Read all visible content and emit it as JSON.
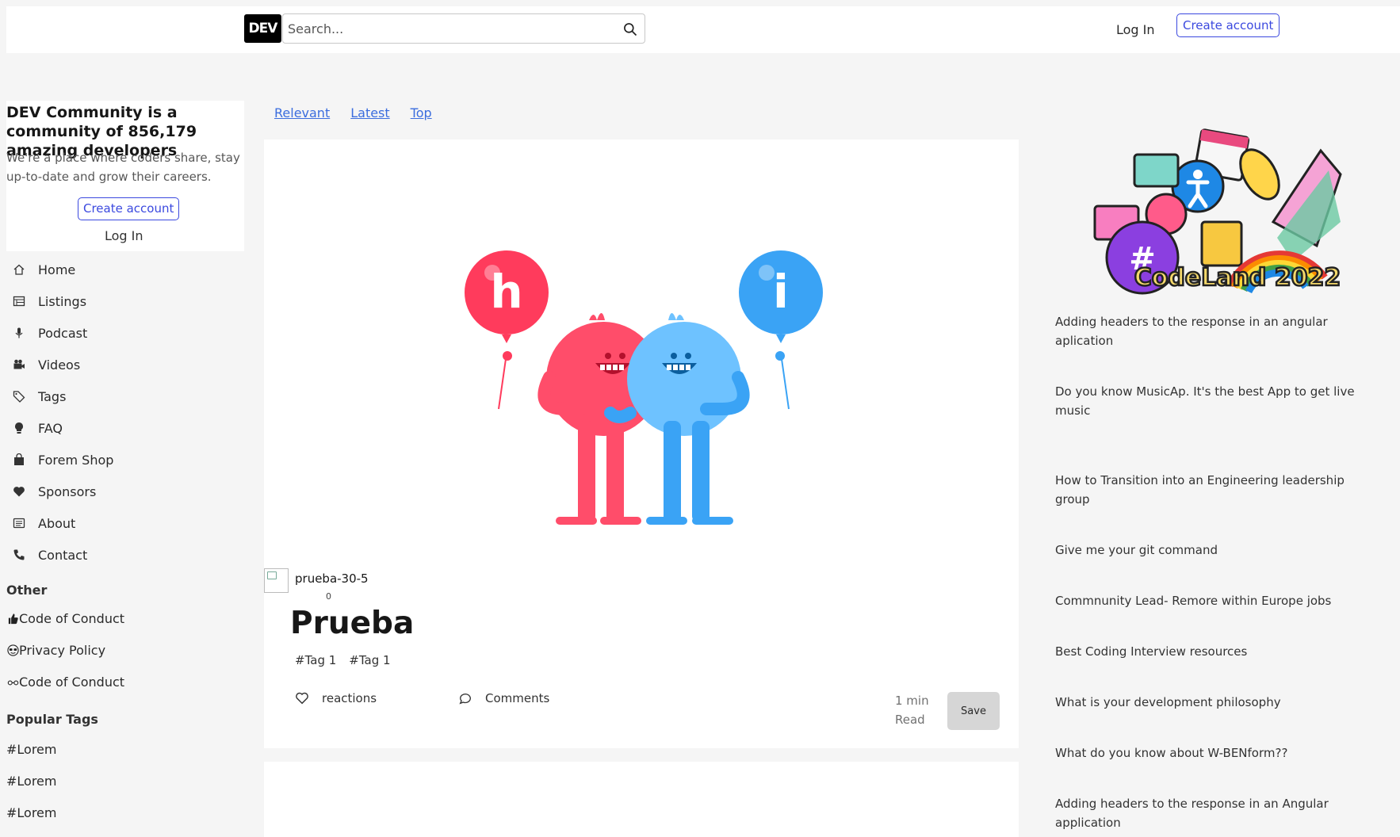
{
  "header": {
    "logo_text": "DEV",
    "search_placeholder": "Search...",
    "login_label": "Log In",
    "create_account_label": "Create account"
  },
  "intro": {
    "title": "DEV Community is a community of 856,179 amazing developers",
    "description": "We're a place where coders share, stay up-to-date and grow their careers.",
    "create_account_label": "Create account",
    "login_label": "Log In"
  },
  "nav": {
    "items": [
      {
        "label": "Home",
        "icon": "home-icon"
      },
      {
        "label": "Listings",
        "icon": "listings-icon"
      },
      {
        "label": "Podcast",
        "icon": "microphone-icon"
      },
      {
        "label": "Videos",
        "icon": "video-camera-icon"
      },
      {
        "label": "Tags",
        "icon": "tag-icon"
      },
      {
        "label": "FAQ",
        "icon": "lightbulb-icon"
      },
      {
        "label": "Forem Shop",
        "icon": "shopping-bag-icon"
      },
      {
        "label": "Sponsors",
        "icon": "heart-icon"
      },
      {
        "label": "About",
        "icon": "about-icon"
      },
      {
        "label": "Contact",
        "icon": "phone-icon"
      }
    ]
  },
  "other": {
    "title": "Other",
    "items": [
      {
        "label": "Code of Conduct",
        "icon": "thumbs-up-icon"
      },
      {
        "label": "Privacy Policy",
        "icon": "sunglasses-icon"
      },
      {
        "label": "Code of Conduct",
        "icon": "glasses-icon"
      }
    ]
  },
  "popular_tags": {
    "title": "Popular Tags",
    "items": [
      "#Lorem",
      "#Lorem",
      "#Lorem"
    ]
  },
  "feed": {
    "tabs": [
      "Relevant",
      "Latest",
      "Top"
    ],
    "post": {
      "author": "prueba-30-5",
      "date": "0",
      "title": "Prueba",
      "tags": [
        "Tag 1",
        "Tag 1"
      ],
      "reactions_label": "reactions",
      "comments_label": "Comments",
      "read_time": "1 min Read",
      "save_label": "Save"
    }
  },
  "right_sidebar": {
    "promo_text": "CodeLand 2022",
    "items": [
      "Adding headers to the response in an angular aplication",
      "Do you know MusicAp. It's the best App to get live music",
      "How to Transition into an Engineering leadership group",
      "Give me your git command",
      "Commnunity Lead- Remore within Europe jobs",
      "Best Coding Interview resources",
      "What is your development philosophy",
      "What do you know about W-BENform??",
      "Adding headers to the response in an Angular application"
    ]
  },
  "colors": {
    "accent": "#3b49df",
    "link": "#3b6dde",
    "balloon_red": "#ff3b5c",
    "balloon_blue": "#3aa3f5"
  }
}
